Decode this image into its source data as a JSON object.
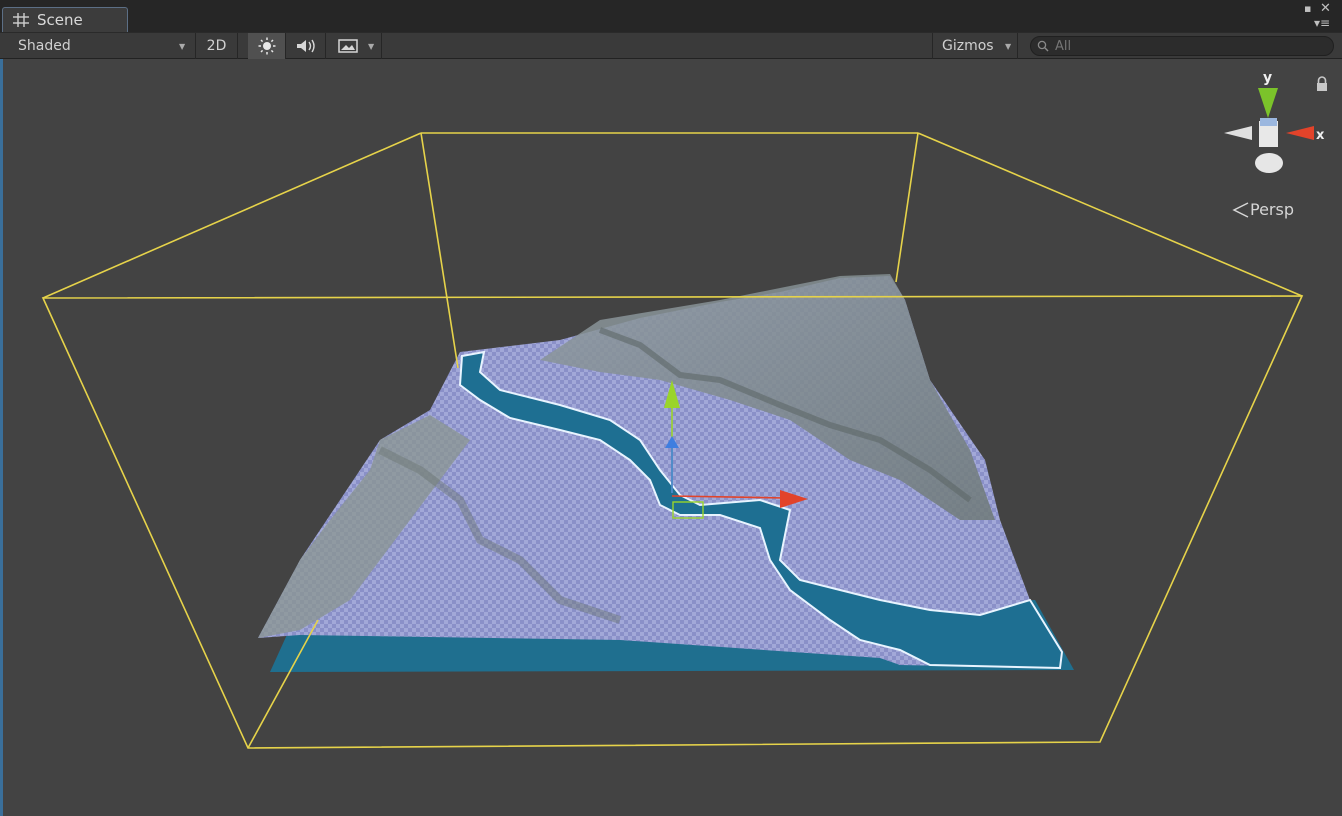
{
  "tab": {
    "label": "Scene"
  },
  "toolbar": {
    "draw_mode": "Shaded",
    "mode_2d": "2D",
    "gizmos": "Gizmos",
    "search_placeholder": "All"
  },
  "viewport": {
    "projection": "Persp",
    "axis_y": "y",
    "axis_x": "x"
  },
  "icons": {
    "tab": "grid-icon",
    "lighting": "sun-icon",
    "audio": "speaker-icon",
    "effects": "image-icon",
    "search": "search-icon",
    "lock": "lock-icon"
  },
  "colors": {
    "bounds": "#e6d34a",
    "axis_x": "#e2432a",
    "axis_y": "#9ad42a",
    "axis_z": "#3f7ee0",
    "water": "#1f6f8f"
  }
}
